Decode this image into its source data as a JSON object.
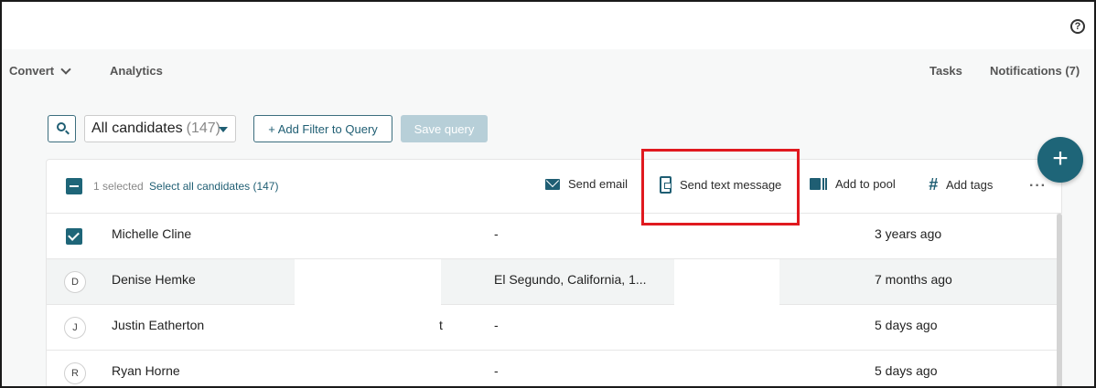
{
  "topbar": {
    "help_icon": "question-circle-icon",
    "help_glyph": "?"
  },
  "nav": {
    "convert_label": "Convert",
    "analytics_label": "Analytics",
    "tasks_label": "Tasks",
    "notifications_label": "Notifications (7)"
  },
  "toolbar": {
    "search_icon": "search-icon",
    "selector_label": "All candidates",
    "selector_count": "(147)",
    "add_filter_label": "+ Add Filter to Query",
    "save_query_label": "Save query",
    "fab_glyph": "+"
  },
  "actionbar": {
    "selected_text": "1 selected",
    "select_all_label": "Select all candidates (147)",
    "send_email_label": "Send email",
    "send_text_label": "Send text message",
    "add_pool_label": "Add to pool",
    "add_tags_label": "Add tags",
    "more_glyph": "···"
  },
  "rows": [
    {
      "initial": "",
      "checked": true,
      "name": "Michelle Cline",
      "fragment": "",
      "location": "-",
      "time": "3 years ago"
    },
    {
      "initial": "D",
      "checked": false,
      "name": "Denise Hemke",
      "fragment": "",
      "location": "El Segundo, California, 1...",
      "time": "7 months ago"
    },
    {
      "initial": "J",
      "checked": false,
      "name": "Justin Eatherton",
      "fragment": "t",
      "location": "-",
      "time": "5 days ago"
    },
    {
      "initial": "R",
      "checked": false,
      "name": "Ryan Horne",
      "fragment": "",
      "location": "-",
      "time": "5 days ago"
    }
  ],
  "colors": {
    "accent": "#1e6578",
    "highlight": "#e0191f",
    "disabled_button": "#b7cfd8"
  }
}
